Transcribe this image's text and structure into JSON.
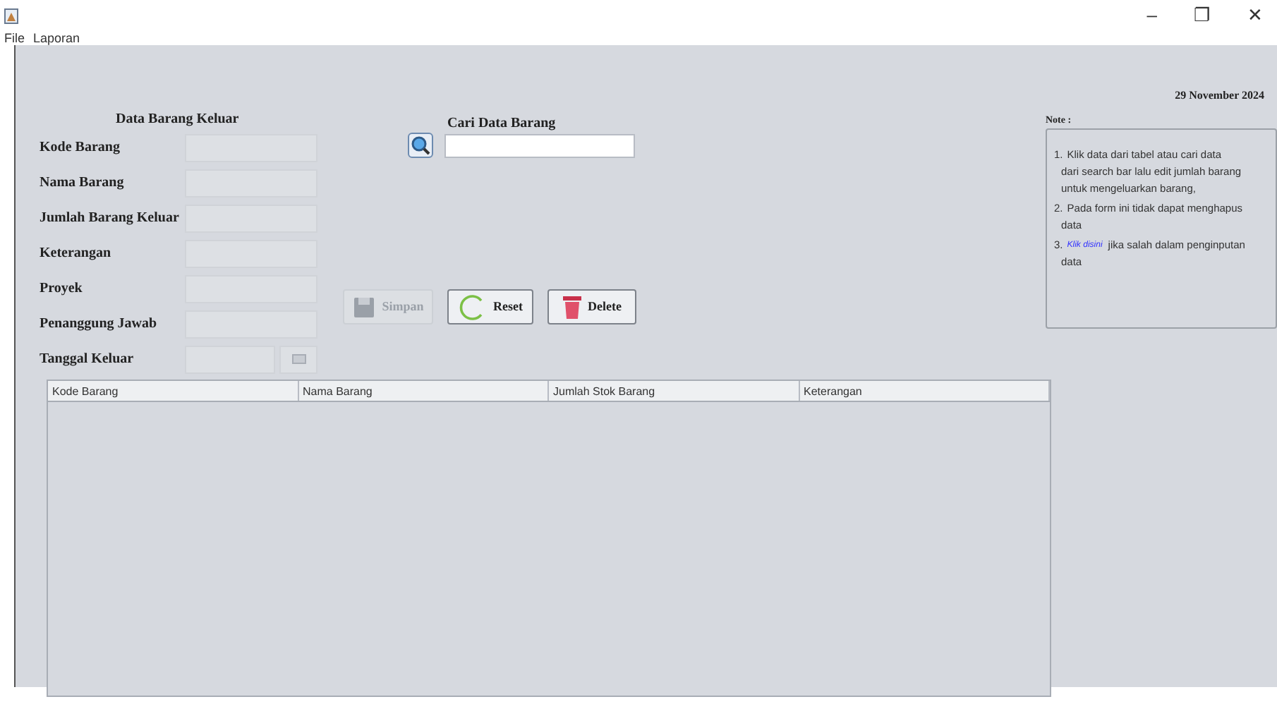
{
  "window": {
    "controls": [
      "–",
      "❐",
      "✕"
    ]
  },
  "menu": [
    {
      "label": "File"
    },
    {
      "label": "Laporan"
    }
  ],
  "date": "29 November 2024",
  "form": {
    "title": "Data Barang Keluar",
    "fields": [
      {
        "label": "Kode Barang",
        "kind": "text"
      },
      {
        "label": "Nama Barang",
        "kind": "text"
      },
      {
        "label": "Jumlah Barang Keluar",
        "kind": "text"
      },
      {
        "label": "Keterangan",
        "kind": "text"
      },
      {
        "label": "Proyek",
        "kind": "text"
      },
      {
        "label": "Penanggung Jawab",
        "kind": "text"
      },
      {
        "label": "Tanggal Keluar",
        "kind": "date"
      }
    ]
  },
  "search": {
    "title": "Cari Data Barang"
  },
  "buttons": [
    {
      "label": "Simpan",
      "kind": "save",
      "disabled": true
    },
    {
      "label": "Reset",
      "kind": "reset",
      "disabled": false
    },
    {
      "label": "Delete",
      "kind": "delete",
      "disabled": false
    }
  ],
  "table": {
    "columns": [
      "Kode Barang",
      "Nama Barang",
      "Jumlah Stok Barang",
      "Keterangan"
    ]
  },
  "note": {
    "label": "Note :",
    "items": [
      {
        "number": "1.",
        "lines": [
          "Klik data dari tabel atau cari data",
          "dari search bar lalu edit jumlah barang",
          "untuk mengeluarkan barang,"
        ]
      },
      {
        "number": "2.",
        "lines": [
          "Pada form ini tidak dapat menghapus",
          "data"
        ]
      },
      {
        "number": "3.",
        "link": "Klik disini",
        "lines": [
          "jika salah dalam penginputan",
          "data"
        ]
      }
    ]
  }
}
